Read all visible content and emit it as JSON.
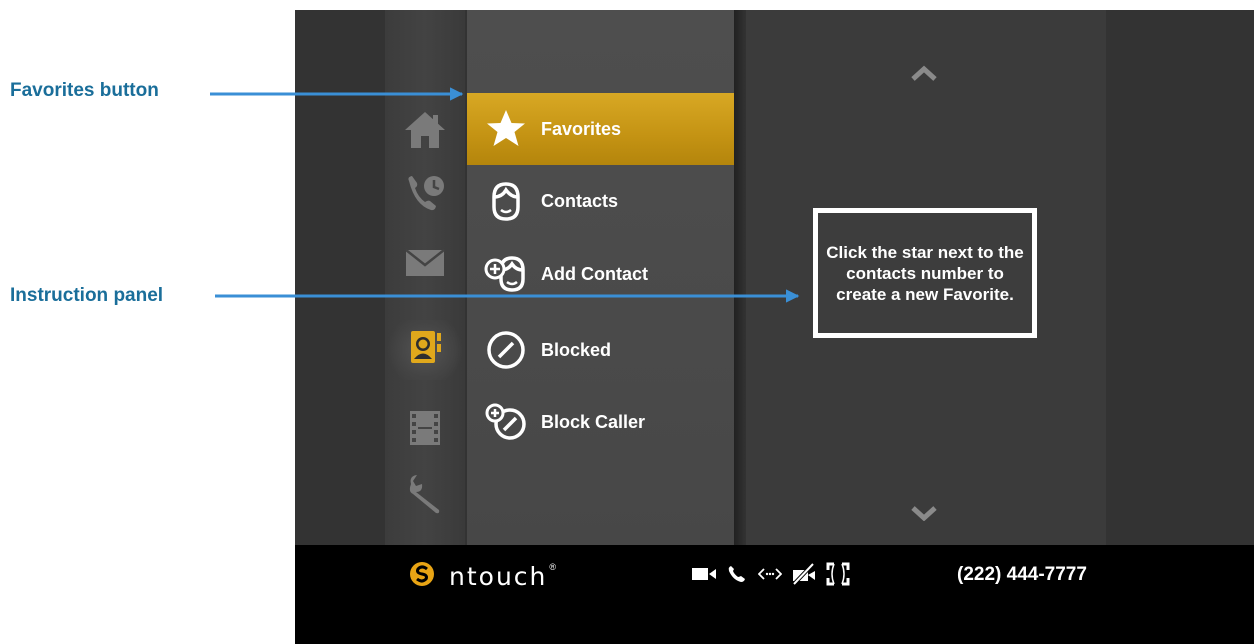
{
  "callouts": {
    "favorites_button": "Favorites button",
    "instruction_panel": "Instruction panel",
    "color": "#1a6e9a",
    "arrow_color": "#3a8fd6"
  },
  "rail": {
    "items": [
      {
        "name": "home",
        "icon": "home-icon"
      },
      {
        "name": "call-history",
        "icon": "call-history-icon"
      },
      {
        "name": "messages",
        "icon": "envelope-icon"
      },
      {
        "name": "contacts",
        "icon": "contacts-book-icon",
        "active": true
      },
      {
        "name": "video",
        "icon": "film-icon"
      },
      {
        "name": "settings",
        "icon": "wrench-icon"
      }
    ]
  },
  "menu": {
    "items": [
      {
        "label": "Favorites",
        "icon": "star-icon",
        "selected": true
      },
      {
        "label": "Contacts",
        "icon": "contact-face-icon"
      },
      {
        "label": "Add Contact",
        "icon": "add-contact-icon"
      },
      {
        "label": "Blocked",
        "icon": "blocked-icon"
      },
      {
        "label": "Block Caller",
        "icon": "block-caller-icon"
      }
    ]
  },
  "panel": {
    "instruction": "Click the star next to the contacts number to create a new Favorite.",
    "scroll_up_icon": "chevron-up-icon",
    "scroll_down_icon": "chevron-down-icon"
  },
  "status_bar": {
    "brand": "ntouch",
    "brand_mark": "®",
    "phone_number": "(222) 444-7777",
    "icons": [
      "video-camera-icon",
      "phone-icon",
      "connection-icon",
      "camera-privacy-icon",
      "fullscreen-icon"
    ]
  },
  "colors": {
    "accent_gold": "#c8981a",
    "screen_bg": "#333333",
    "menu_bg": "#4a4a4a",
    "bottom_bar": "#000000"
  }
}
